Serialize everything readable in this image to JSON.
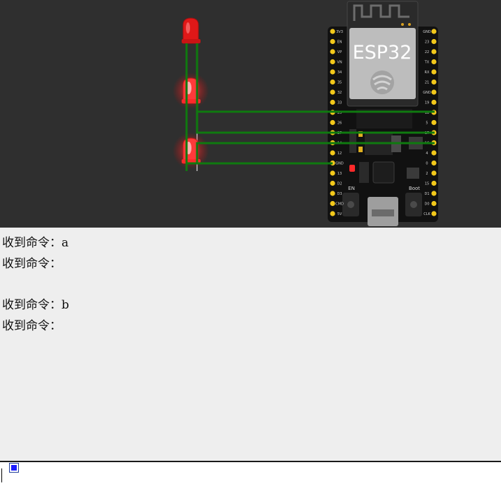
{
  "simulator": {
    "board": {
      "chip_label": "ESP32",
      "en_button_label": "EN",
      "boot_button_label": "Boot",
      "left_pins": [
        "3V3",
        "EN",
        "VP",
        "VN",
        "34",
        "35",
        "32",
        "33",
        "25",
        "26",
        "27",
        "14",
        "12",
        "GND",
        "13",
        "D2",
        "D3",
        "CMD",
        "5V"
      ],
      "right_pins": [
        "GND",
        "23",
        "22",
        "TX",
        "RX",
        "21",
        "GND",
        "19",
        "18",
        "5",
        "17",
        "16",
        "4",
        "0",
        "2",
        "15",
        "D1",
        "D0",
        "CLK"
      ],
      "colors": {
        "board": "#111111",
        "pin": "#f2c81b",
        "chip": "#bdbdbd",
        "power_led": "#ff2a2a"
      }
    },
    "leds": [
      {
        "color": "#e01818",
        "lit": false
      },
      {
        "color": "#ff3a3a",
        "lit": true
      },
      {
        "color": "#ff3a3a",
        "lit": true
      }
    ],
    "wire_color": "#0f7a0f"
  },
  "console": {
    "lines": [
      "收到命令：a",
      "收到命令：",
      "",
      "收到命令：b",
      "收到命令："
    ]
  },
  "input": {
    "value": ""
  }
}
